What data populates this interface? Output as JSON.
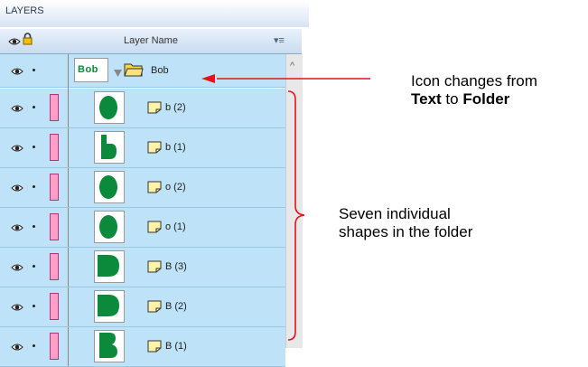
{
  "panel": {
    "title": "LAYERS",
    "header": {
      "column_label": "Layer Name",
      "menu_icon": "panel-menu-icon"
    },
    "group": {
      "name": "Bob",
      "thumb_text": "Bob",
      "icon": "folder-icon"
    },
    "layers": [
      {
        "name": "b (2)",
        "shape": "o"
      },
      {
        "name": "b (1)",
        "shape": "b"
      },
      {
        "name": "o (2)",
        "shape": "o"
      },
      {
        "name": "o (1)",
        "shape": "o"
      },
      {
        "name": "B (3)",
        "shape": "D"
      },
      {
        "name": "B (2)",
        "shape": "D"
      },
      {
        "name": "B (1)",
        "shape": "B"
      }
    ],
    "layer_color": "#ff9ec7",
    "row_color": "#bee3f8",
    "shape_color": "#0a8a3a"
  },
  "annotations": {
    "icon_change_line1": "Icon changes from",
    "icon_change_text": "Text",
    "icon_change_to": " to ",
    "icon_change_folder": "Folder",
    "seven_line1": "Seven individual",
    "seven_line2": "shapes in the folder",
    "arrow_color": "#e8101a"
  }
}
